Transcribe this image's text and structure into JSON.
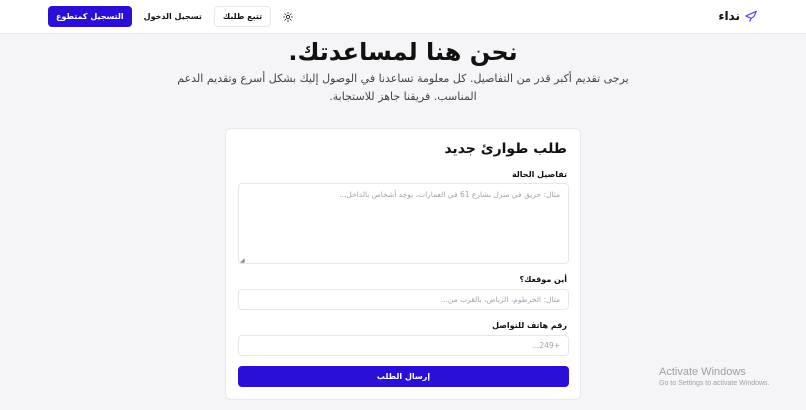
{
  "nav": {
    "brand": "نداء",
    "volunteer_button": "التسجيل كمتطوع",
    "login_link": "تسجيل الدخول",
    "track_button": "تتبع طلبك"
  },
  "hero": {
    "title": "نحن هنا لمساعدتك.",
    "subtitle": "يرجى تقديم أكبر قدر من التفاصيل. كل معلومة تساعدنا في الوصول إليك بشكل أسرع وتقديم الدعم المناسب. فريقنا جاهز للاستجابة."
  },
  "form": {
    "title": "طلب طوارئ جديد",
    "details_label": "تفاصيل الحالة",
    "details_placeholder": "مثال: حريق في منزل بشارع 61 في العمارات، يوجد أشخاص بالداخل...",
    "location_label": "أين موقعك؟",
    "location_placeholder": "مثال: الخرطوم، الرياض، بالقرب من...",
    "phone_label": "رقم هاتف للتواصل",
    "phone_placeholder": "+249...",
    "submit_label": "إرسال الطلب"
  },
  "watermark": {
    "title": "Activate Windows",
    "subtitle": "Go to Settings to activate Windows."
  },
  "colors": {
    "primary": "#2a10d6",
    "brand_icon": "#5b3df5"
  },
  "icons": {
    "brand": "broadcast-icon",
    "theme_toggle": "sun-icon"
  }
}
